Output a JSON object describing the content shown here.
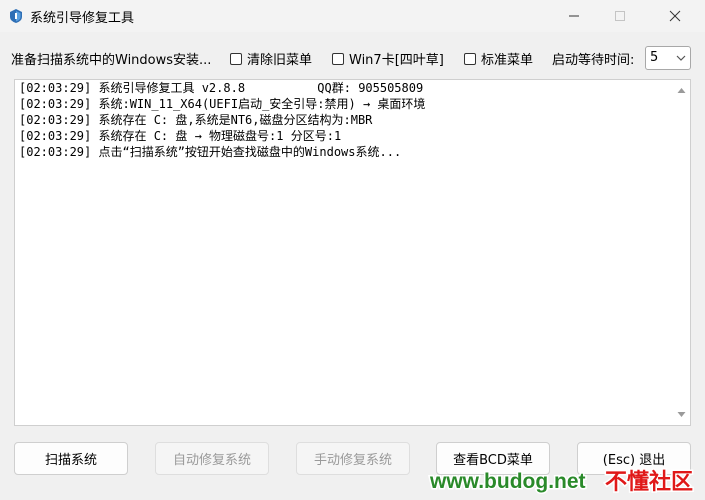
{
  "window": {
    "title": "系统引导修复工具",
    "icon": "app-icon"
  },
  "toolbar": {
    "status_label": "准备扫描系统中的Windows安装...",
    "checkbox_clear_old": "清除旧菜单",
    "checkbox_win7": "Win7卡[四叶草]",
    "checkbox_standard": "标准菜单",
    "delay_label": "启动等待时间:",
    "delay_value": "5"
  },
  "log": {
    "lines": [
      "[02:03:29] 系统引导修复工具 v2.8.8          QQ群: 905505809",
      "[02:03:29] 系统:WIN_11_X64(UEFI启动_安全引导:禁用) → 桌面环境",
      "[02:03:29] 系统存在 C: 盘,系统是NT6,磁盘分区结构为:MBR",
      "[02:03:29] 系统存在 C: 盘 → 物理磁盘号:1 分区号:1",
      "[02:03:29] 点击“扫描系统”按钮开始查找磁盘中的Windows系统..."
    ]
  },
  "buttons": {
    "scan": "扫描系统",
    "auto_repair": "自动修复系统",
    "manual_repair": "手动修复系统",
    "view_bcd": "查看BCD菜单",
    "exit": "(Esc) 退出"
  },
  "watermark": {
    "url": "www.budog.net",
    "brand": "不懂社区"
  },
  "colors": {
    "watermark_url": "#2a8a2a",
    "watermark_brand": "#e01818",
    "disabled_text": "#9a9a9a"
  }
}
